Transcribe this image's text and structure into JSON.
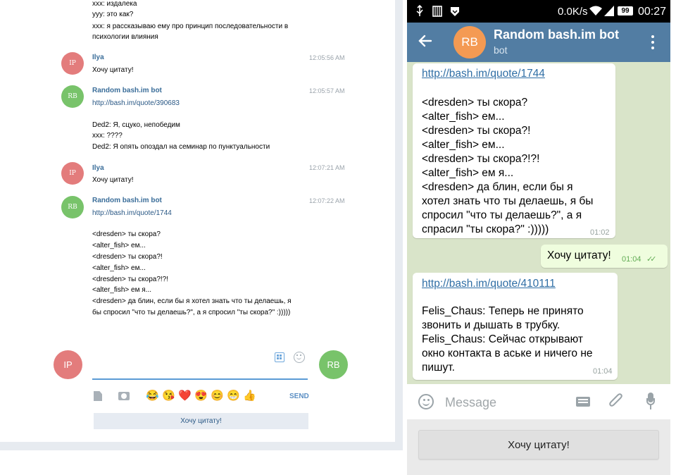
{
  "desktop": {
    "history_top": [
      "xxx: издалека",
      "yyy: это как?",
      "xxx: я рассказываю ему про принцип последовательности в",
      "психологии влияния"
    ],
    "messages": [
      {
        "avatar": "IP",
        "name": "Ilya",
        "time": "12:05:56 AM",
        "text": "Хочу цитату!"
      },
      {
        "avatar": "RB",
        "name": "Random bash.im bot",
        "time": "12:05:57 AM",
        "link": "http://bash.im/quote/390683",
        "lines": [
          "Ded2: Я, сцуко, непобедим",
          "xxx: ????",
          "Ded2: Я опять опоздал на семинар по пунктуальности"
        ]
      },
      {
        "avatar": "IP",
        "name": "Ilya",
        "time": "12:07:21 AM",
        "text": "Хочу цитату!"
      },
      {
        "avatar": "RB",
        "name": "Random bash.im bot",
        "time": "12:07:22 AM",
        "link": "http://bash.im/quote/1744",
        "lines": [
          "<dresden> ты скора?",
          "<alter_fish> ем...",
          "<dresden> ты скора?!",
          "<alter_fish> ем...",
          "<dresden> ты скора?!?!",
          "<alter_fish> ем я...",
          "<dresden> да блин, если бы я хотел знать что ты делаешь, я",
          "бы спросил \"что ты делаешь?\", а я спросил \"ты скора?\" :)))))"
        ]
      }
    ],
    "composer": {
      "my_avatar": "IP",
      "peer_avatar": "RB",
      "send_label": "SEND",
      "emoji": [
        "😂",
        "😘",
        "❤️",
        "😍",
        "😊",
        "😁",
        "👍"
      ]
    },
    "quick_reply": "Хочу цитату!"
  },
  "phone": {
    "status": {
      "speed": "0.0K/s",
      "battery": "99",
      "time": "00:27"
    },
    "header": {
      "avatar": "RB",
      "title": "Random bash.im bot",
      "subtitle": "bot"
    },
    "messages": [
      {
        "link": "http://bash.im/quote/1744",
        "lines": [
          "<dresden> ты скора?",
          "<alter_fish> ем...",
          "<dresden> ты скора?!",
          "<alter_fish> ем...",
          "<dresden> ты скора?!?!",
          "<alter_fish> ем я...",
          "<dresden> да блин, если бы я",
          "хотел знать что ты делаешь, я бы",
          "спросил \"что ты делаешь?\", а я",
          "спрасил \"ты скора?\" :)))))"
        ],
        "time": "01:02"
      },
      {
        "outgoing": true,
        "text": "Хочу цитату!",
        "time": "01:04",
        "checks": "✓✓"
      },
      {
        "link": "http://bash.im/quote/410111",
        "lines": [
          "Felis_Chaus: Теперь не принято",
          "звонить и дышать в трубку.",
          "Felis_Chaus: Сейчас открывают",
          "окно контакта в аське и ничего не",
          "пишут."
        ],
        "time": "01:04"
      }
    ],
    "composer": {
      "placeholder": "Message"
    },
    "keyboard_button": "Хочу цитату!"
  },
  "colors": {
    "telegram_header": "#527da3",
    "chat_background": "#d9e4c9",
    "outgoing_bubble": "#effdde",
    "avatar_ilya": "#e37c7c",
    "avatar_bot_desktop": "#78c36a",
    "avatar_bot_phone": "#f49a53"
  }
}
